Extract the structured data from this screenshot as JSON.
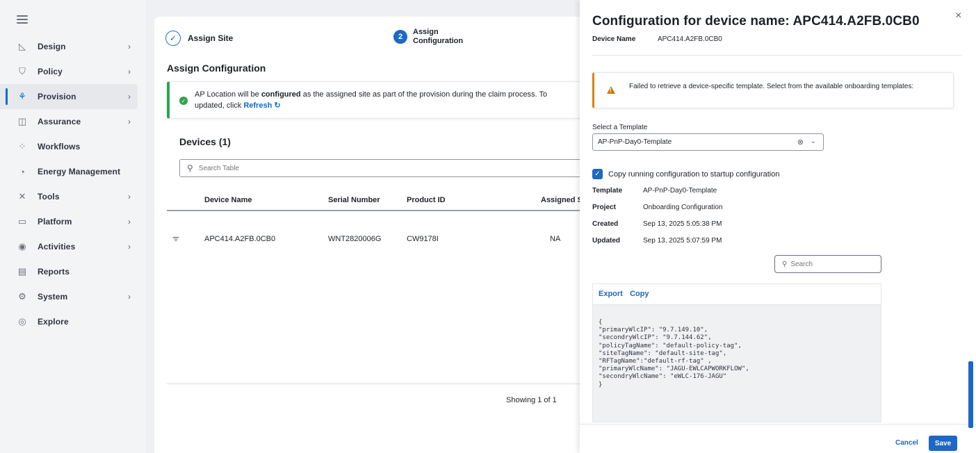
{
  "sidebar": {
    "items": [
      {
        "label": "Design",
        "icon": "ruler-pencil-icon",
        "glyph": "◺",
        "has_chevron": true
      },
      {
        "label": "Policy",
        "icon": "shield-icon",
        "glyph": "⛉",
        "has_chevron": true
      },
      {
        "label": "Provision",
        "icon": "provision-icon",
        "glyph": "⚘",
        "has_chevron": true
      },
      {
        "label": "Assurance",
        "icon": "assurance-icon",
        "glyph": "◫",
        "has_chevron": true
      },
      {
        "label": "Workflows",
        "icon": "workflow-icon",
        "glyph": "⁘",
        "has_chevron": false
      },
      {
        "label": "Energy Management",
        "icon": "energy-icon",
        "glyph": "◔",
        "has_chevron": false
      },
      {
        "label": "Tools",
        "icon": "tools-icon",
        "glyph": "✕",
        "has_chevron": true
      },
      {
        "label": "Platform",
        "icon": "platform-icon",
        "glyph": "▭",
        "has_chevron": true
      },
      {
        "label": "Activities",
        "icon": "activities-icon",
        "glyph": "◉",
        "has_chevron": true
      },
      {
        "label": "Reports",
        "icon": "reports-icon",
        "glyph": "▤",
        "has_chevron": false
      },
      {
        "label": "System",
        "icon": "gear-icon",
        "glyph": "⚙",
        "has_chevron": true
      },
      {
        "label": "Explore",
        "icon": "compass-icon",
        "glyph": "◎",
        "has_chevron": false
      }
    ],
    "active": "Provision"
  },
  "steps": {
    "step1": "Assign Site",
    "step2_num": "2",
    "step2_line1": "Assign",
    "step2_line2": "Configuration"
  },
  "main": {
    "section_title": "Assign Configuration",
    "alert": {
      "pre": "AP Location will be ",
      "bold": "configured",
      "post": " as the assigned site as part of the provision during the claim process. To",
      "line2_pre": "updated, click ",
      "link": "Refresh",
      "refresh_glyph": "↻"
    },
    "devices_title": "Devices (1)",
    "search_placeholder": "Search Table",
    "table": {
      "headers": [
        "Device Name",
        "Serial Number",
        "Product ID",
        "Assigned S"
      ],
      "rows": [
        {
          "device_name": "APC414.A2FB.0CB0",
          "serial": "WNT2820006G",
          "product": "CW9178I",
          "assigned": "NA"
        }
      ]
    },
    "showing": "Showing 1 of 1"
  },
  "panel": {
    "title": "Configuration for device name: APC414.A2FB.0CB0",
    "close": "×",
    "device_name_label": "Device Name",
    "device_name_value": "APC414.A2FB.0CB0",
    "warning": "Failed to retrieve a device-specific template. Select from the available onboarding templates:",
    "select_label": "Select a Template",
    "select_value": "AP-PnP-Day0-Template",
    "checkbox_label": "Copy running configuration to startup configuration",
    "details": [
      {
        "k": "Template",
        "v": "AP-PnP-Day0-Template"
      },
      {
        "k": "Project",
        "v": "Onboarding Configuration"
      },
      {
        "k": "Created",
        "v": "Sep 13, 2025 5:05:38 PM"
      },
      {
        "k": "Updated",
        "v": "Sep 13, 2025 5:07:59 PM"
      }
    ],
    "search_placeholder": "Search",
    "export": "Export",
    "copy": "Copy",
    "code": "{\n\"primaryWlcIP\": \"9.7.149.10\",\n\"secondryWlcIP\": \"9.7.144.62\",\n\"policyTagName\": \"default-policy-tag\",\n\"siteTagName\": \"default-site-tag\",\n\"RFTagName\":\"default-rf-tag\" ,\n\"primaryWlcName\": \"JAGU-EWLCAPWORKFLOW\",\n\"secondryWlcName\": \"eWLC-176-JAGU\"\n}",
    "cancel": "Cancel",
    "save": "Save"
  },
  "colors": {
    "accent": "#1d67c7",
    "success": "#2ea44f",
    "warning": "#d58512"
  }
}
